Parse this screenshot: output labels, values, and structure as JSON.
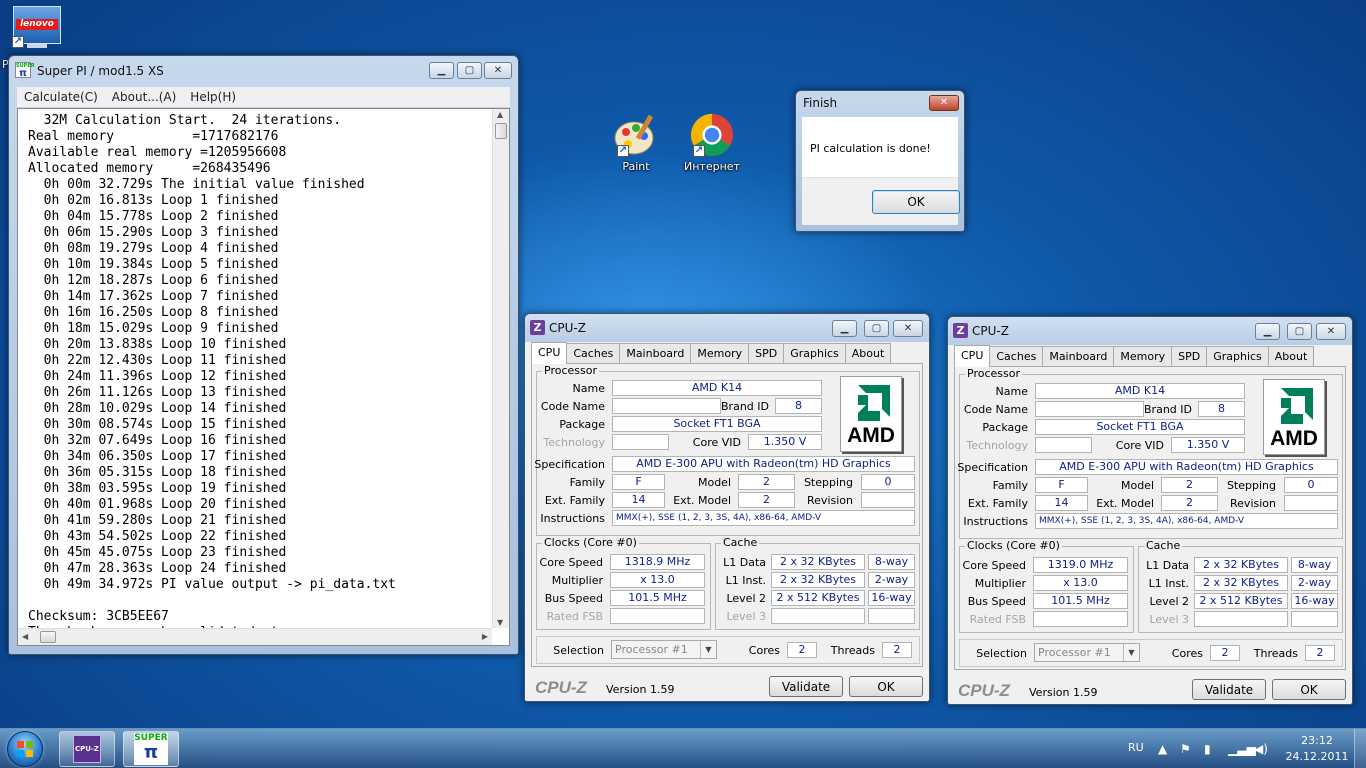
{
  "desktop": {
    "icons": [
      {
        "label": ""
      },
      {
        "label": "Paint"
      },
      {
        "label": "Интернет"
      }
    ],
    "lenovo_logo_text": "lenovo",
    "edge_letter": "P"
  },
  "superpi": {
    "title": "Super PI / mod1.5 XS",
    "icon_text": "SUPER",
    "menu": [
      "Calculate(C)",
      "About...(A)",
      "Help(H)"
    ],
    "log_lines": [
      "  32M Calculation Start.  24 iterations.",
      "Real memory          =1717682176",
      "Available real memory =1205956608",
      "Allocated memory     =268435496",
      "  0h 00m 32.729s The initial value finished",
      "  0h 02m 16.813s Loop 1 finished",
      "  0h 04m 15.778s Loop 2 finished",
      "  0h 06m 15.290s Loop 3 finished",
      "  0h 08m 19.279s Loop 4 finished",
      "  0h 10m 19.384s Loop 5 finished",
      "  0h 12m 18.287s Loop 6 finished",
      "  0h 14m 17.362s Loop 7 finished",
      "  0h 16m 16.250s Loop 8 finished",
      "  0h 18m 15.029s Loop 9 finished",
      "  0h 20m 13.838s Loop 10 finished",
      "  0h 22m 12.430s Loop 11 finished",
      "  0h 24m 11.396s Loop 12 finished",
      "  0h 26m 11.126s Loop 13 finished",
      "  0h 28m 10.029s Loop 14 finished",
      "  0h 30m 08.574s Loop 15 finished",
      "  0h 32m 07.649s Loop 16 finished",
      "  0h 34m 06.350s Loop 17 finished",
      "  0h 36m 05.315s Loop 18 finished",
      "  0h 38m 03.595s Loop 19 finished",
      "  0h 40m 01.968s Loop 20 finished",
      "  0h 41m 59.280s Loop 21 finished",
      "  0h 43m 54.502s Loop 22 finished",
      "  0h 45m 45.075s Loop 23 finished",
      "  0h 47m 28.363s Loop 24 finished",
      "  0h 49m 34.972s PI value output -> pi_data.txt",
      "",
      "Checksum: 3CB5EE67",
      "The checksum can be validated at"
    ]
  },
  "finish_dialog": {
    "title": "Finish",
    "message": "PI calculation is done!",
    "ok_label": "OK"
  },
  "cpuz_common": {
    "title": "CPU-Z",
    "icon_letter": "Z",
    "tabs": [
      "CPU",
      "Caches",
      "Mainboard",
      "Memory",
      "SPD",
      "Graphics",
      "About"
    ],
    "group_processor": "Processor",
    "group_clocks": "Clocks (Core #0)",
    "group_cache": "Cache",
    "labels": {
      "name": "Name",
      "code_name": "Code Name",
      "brand_id": "Brand ID",
      "package": "Package",
      "technology": "Technology",
      "core_vid": "Core VID",
      "specification": "Specification",
      "family": "Family",
      "model": "Model",
      "stepping": "Stepping",
      "ext_family": "Ext. Family",
      "ext_model": "Ext. Model",
      "revision": "Revision",
      "instructions": "Instructions",
      "core_speed": "Core Speed",
      "multiplier": "Multiplier",
      "bus_speed": "Bus Speed",
      "rated_fsb": "Rated FSB",
      "l1_data": "L1 Data",
      "l1_inst": "L1 Inst.",
      "level2": "Level 2",
      "level3": "Level 3",
      "selection": "Selection",
      "cores": "Cores",
      "threads": "Threads"
    },
    "amd_text": "AMD",
    "brandmark": "CPU-Z",
    "version": "Version 1.59",
    "validate_label": "Validate",
    "ok_label": "OK"
  },
  "cpuz_windows": [
    {
      "name": "AMD K14",
      "code_name": "",
      "brand_id": "8",
      "package": "Socket FT1 BGA",
      "technology": "",
      "core_vid": "1.350 V",
      "specification": "AMD E-300 APU with Radeon(tm) HD Graphics",
      "family": "F",
      "model": "2",
      "stepping": "0",
      "ext_family": "14",
      "ext_model": "2",
      "revision": "",
      "instructions": "MMX(+), SSE (1, 2, 3, 3S, 4A), x86-64, AMD-V",
      "core_speed": "1318.9 MHz",
      "multiplier": "x 13.0",
      "bus_speed": "101.5 MHz",
      "rated_fsb": "",
      "l1_data": "2 x 32 KBytes",
      "l1_data_way": "8-way",
      "l1_inst": "2 x 32 KBytes",
      "l1_inst_way": "2-way",
      "level2": "2 x 512 KBytes",
      "level2_way": "16-way",
      "level3": "",
      "level3_way": "",
      "selection": "Processor #1",
      "cores": "2",
      "threads": "2"
    },
    {
      "name": "AMD K14",
      "code_name": "",
      "brand_id": "8",
      "package": "Socket FT1 BGA",
      "technology": "",
      "core_vid": "1.350 V",
      "specification": "AMD E-300 APU with Radeon(tm) HD Graphics",
      "family": "F",
      "model": "2",
      "stepping": "0",
      "ext_family": "14",
      "ext_model": "2",
      "revision": "",
      "instructions": "MMX(+), SSE (1, 2, 3, 3S, 4A), x86-64, AMD-V",
      "core_speed": "1319.0 MHz",
      "multiplier": "x 13.0",
      "bus_speed": "101.5 MHz",
      "rated_fsb": "",
      "l1_data": "2 x 32 KBytes",
      "l1_data_way": "8-way",
      "l1_inst": "2 x 32 KBytes",
      "l1_inst_way": "2-way",
      "level2": "2 x 512 KBytes",
      "level2_way": "16-way",
      "level3": "",
      "level3_way": "",
      "selection": "Processor #1",
      "cores": "2",
      "threads": "2"
    }
  ],
  "taskbar": {
    "cpuz_icon_text": "CPU-Z",
    "superpi_icon_text": "SUPER",
    "language": "RU",
    "time": "23:12",
    "date": "24.12.2011"
  },
  "colors": {
    "desktop_blue": "#0f5aaa",
    "value_text": "#0b1f86",
    "close_red": "#c0422c"
  }
}
